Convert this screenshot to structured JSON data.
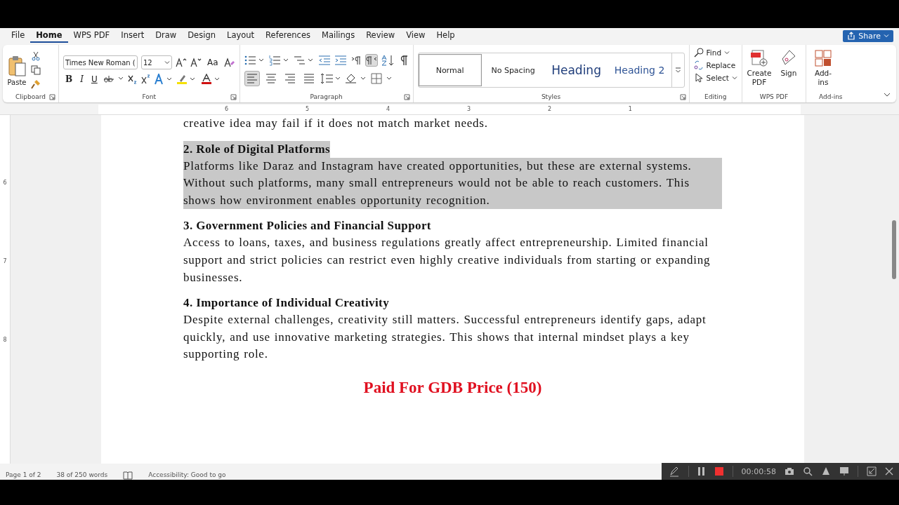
{
  "menu_tabs": [
    {
      "label": "File",
      "selected": false
    },
    {
      "label": "Home",
      "selected": true
    },
    {
      "label": "WPS PDF",
      "selected": false
    },
    {
      "label": "Insert",
      "selected": false
    },
    {
      "label": "Draw",
      "selected": false
    },
    {
      "label": "Design",
      "selected": false
    },
    {
      "label": "Layout",
      "selected": false
    },
    {
      "label": "References",
      "selected": false
    },
    {
      "label": "Mailings",
      "selected": false
    },
    {
      "label": "Review",
      "selected": false
    },
    {
      "label": "View",
      "selected": false
    },
    {
      "label": "Help",
      "selected": false
    }
  ],
  "share_button": "Share",
  "clipboard": {
    "paste": "Paste",
    "group": "Clipboard"
  },
  "font": {
    "name": "Times New Roman (",
    "size": "12",
    "case_button": "Aa",
    "bold": "B",
    "italic": "I",
    "underline": "U",
    "group": "Font"
  },
  "paragraph": {
    "group": "Paragraph",
    "alignment": [
      {
        "kind": "left",
        "selected": true
      },
      {
        "kind": "center",
        "selected": false
      },
      {
        "kind": "right",
        "selected": false
      },
      {
        "kind": "justify",
        "selected": false
      }
    ],
    "rtl_selected": true
  },
  "styles": {
    "group": "Styles",
    "items": [
      {
        "label": "Normal",
        "kind": "normal",
        "selected": true
      },
      {
        "label": "No Spacing",
        "kind": "normal",
        "selected": false
      },
      {
        "label": "Heading",
        "kind": "heading1",
        "selected": false
      },
      {
        "label": "Heading 2",
        "kind": "heading2",
        "selected": false
      }
    ]
  },
  "editing": {
    "group": "Editing",
    "find": "Find",
    "replace": "Replace",
    "select": "Select"
  },
  "wps_pdf": {
    "group": "WPS PDF",
    "create": "Create PDF",
    "sign": "Sign"
  },
  "addins": {
    "group": "Add-ins",
    "button": "Add-ins"
  },
  "ruler_labels": [
    "6",
    "5",
    "4",
    "3",
    "2",
    "1"
  ],
  "vertical_ruler_labels": [
    "6",
    "7",
    "8"
  ],
  "document": {
    "partial_line": "creative idea may fail if it does not match market needs.",
    "sections": [
      {
        "heading": "2. Role of Digital Platforms",
        "body": "Platforms like Daraz and Instagram have created opportunities, but these are external systems. Without such platforms, many small entrepreneurs would not be able to reach customers. This shows how environment enables opportunity recognition.",
        "selected": true
      },
      {
        "heading": "3. Government Policies and Financial Support",
        "body": "Access to loans, taxes, and business regulations greatly affect entrepreneurship. Limited financial support and strict policies can restrict even highly creative individuals from starting or expanding businesses.",
        "selected": false
      },
      {
        "heading": "4. Importance of Individual Creativity",
        "body": "Despite external challenges, creativity still matters. Successful entrepreneurs identify gaps, adapt quickly, and use innovative marketing strategies. This shows that internal mindset plays a key supporting role.",
        "selected": false
      }
    ],
    "price_note": "Paid For GDB Price (150)"
  },
  "status_bar": {
    "page": "Page 1 of 2",
    "words": "38 of 250 words",
    "accessibility": "Accessibility: Good to go"
  },
  "recorder_bar": {
    "time": "00:00:58"
  }
}
